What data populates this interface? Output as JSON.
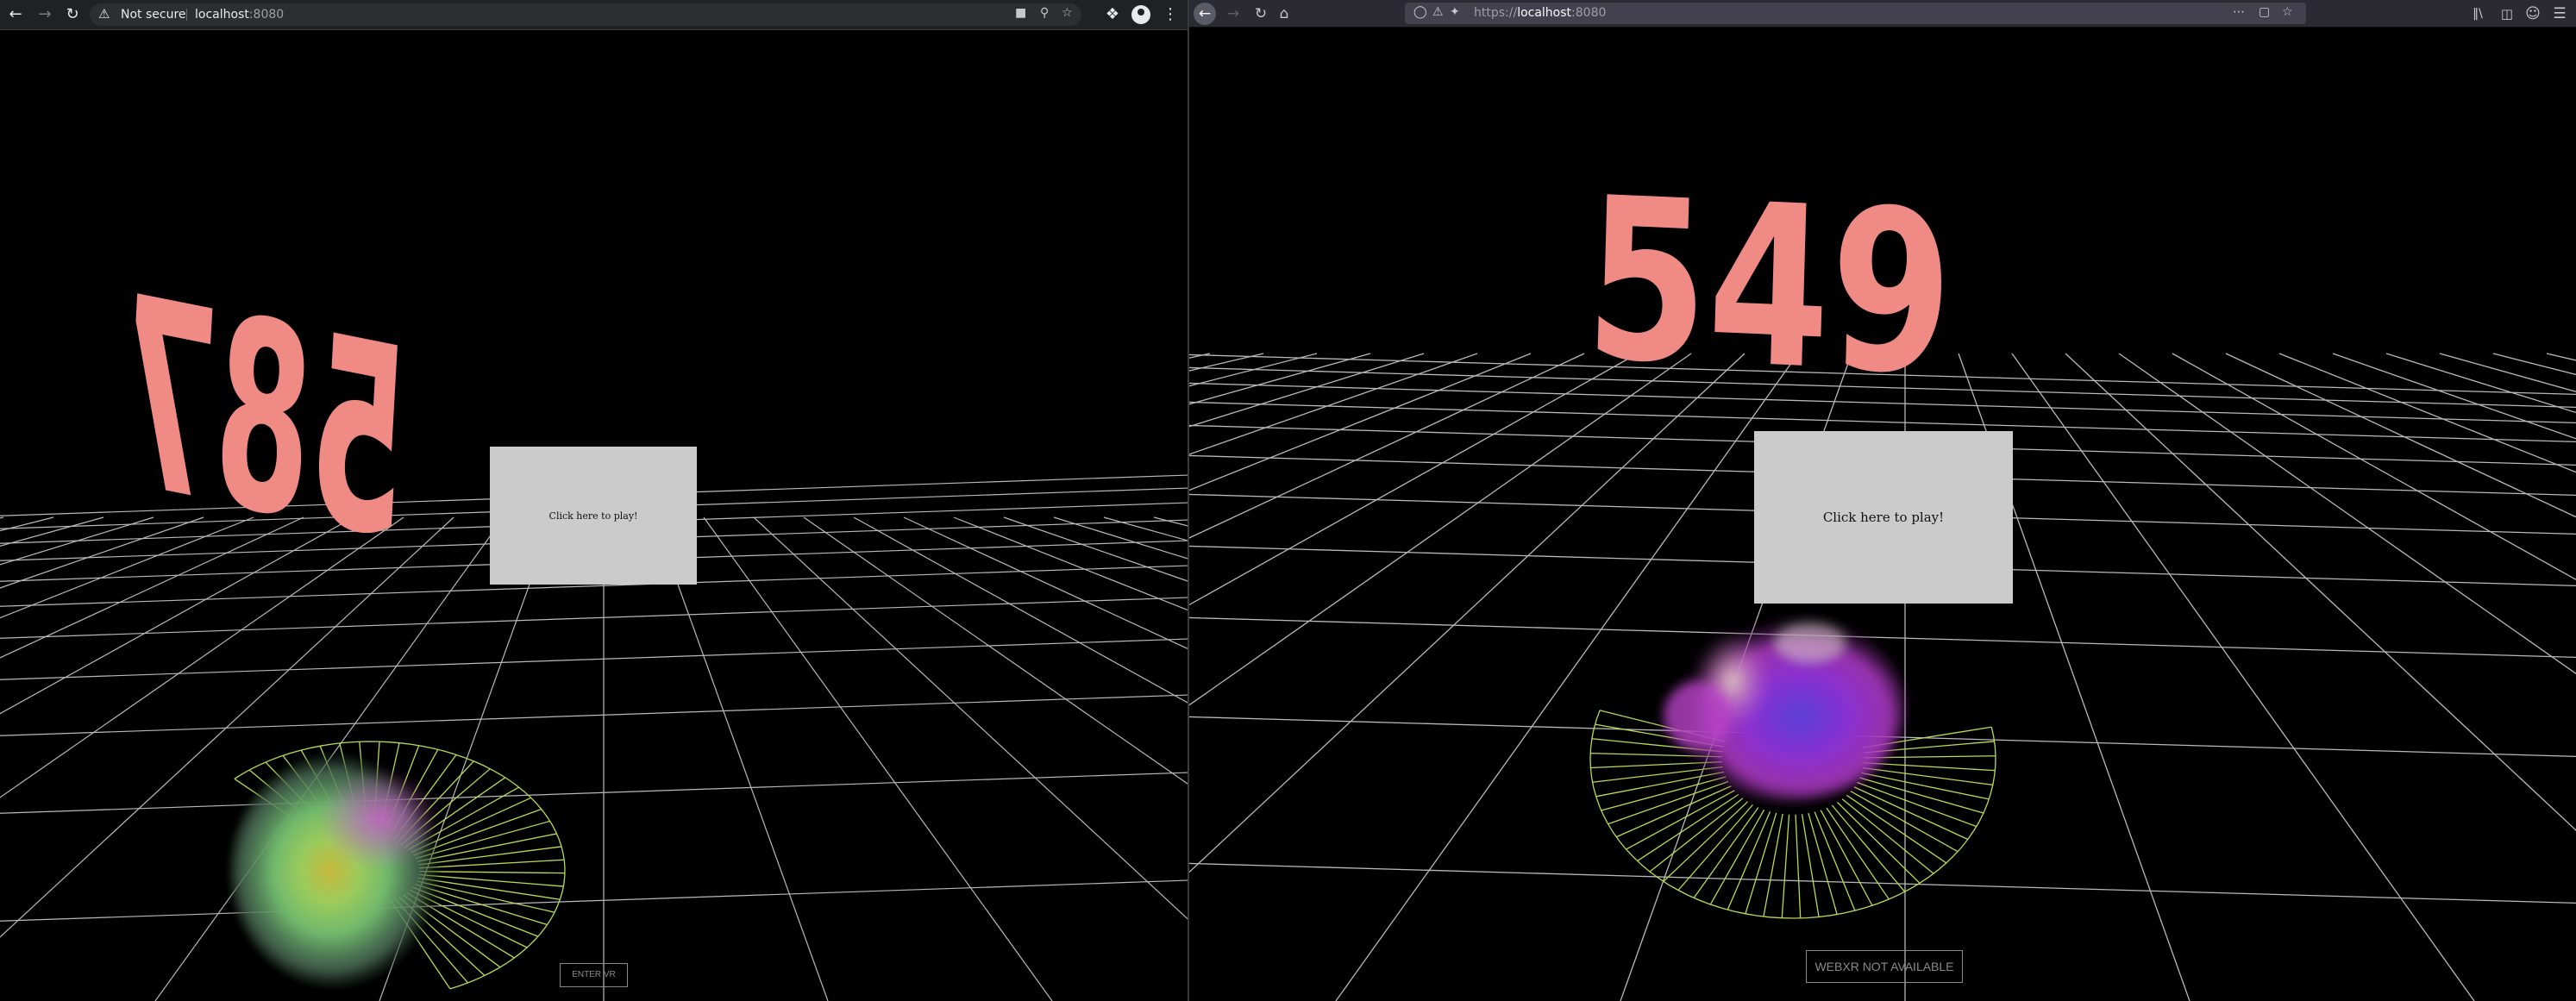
{
  "left_browser": {
    "omnibox": {
      "security_text": "Not secure",
      "host": "localhost",
      "port": ":8080"
    },
    "scene": {
      "score_mirrored": "587",
      "play_prompt": "Click here to play!",
      "vr_button": "ENTER VR"
    }
  },
  "right_browser": {
    "url": {
      "scheme": "https://",
      "host": "localhost",
      "port": ":8080"
    },
    "scene": {
      "score": "549",
      "play_prompt": "Click here to play!",
      "vr_button": "WEBXR NOT AVAILABLE"
    }
  },
  "colors": {
    "score_pink": "#ef8a84",
    "grid_line": "#e8e8e8",
    "aura_line": "#b6dc54",
    "play_box_bg": "#cbcbcb"
  }
}
